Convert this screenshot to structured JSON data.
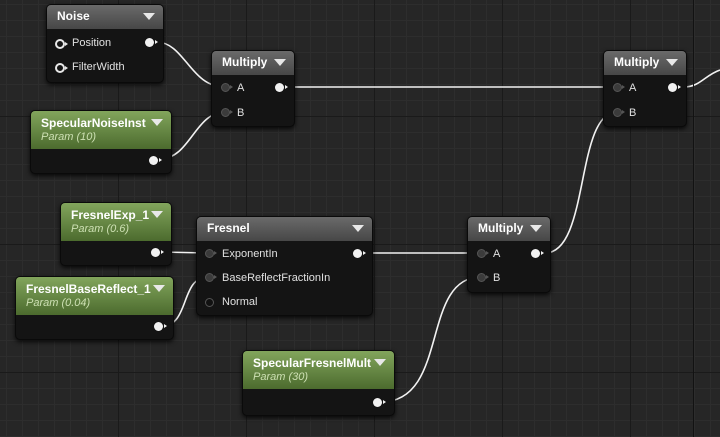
{
  "nodes": {
    "noise": {
      "title": "Noise",
      "inputs": [
        "Position",
        "FilterWidth"
      ]
    },
    "multiply1": {
      "title": "Multiply",
      "inputs": [
        "A",
        "B"
      ]
    },
    "multiply2": {
      "title": "Multiply",
      "inputs": [
        "A",
        "B"
      ]
    },
    "multiply3": {
      "title": "Multiply",
      "inputs": [
        "A",
        "B"
      ]
    },
    "specular_noise_inst": {
      "title": "SpecularNoiseInst",
      "subtitle": "Param (10)"
    },
    "fresnel_exp": {
      "title": "FresnelExp_1",
      "subtitle": "Param (0.6)"
    },
    "fresnel_base_reflect": {
      "title": "FresnelBaseReflect_1",
      "subtitle": "Param (0.04)"
    },
    "specular_fresnel_mult": {
      "title": "SpecularFresnelMult",
      "subtitle": "Param (30)"
    },
    "fresnel": {
      "title": "Fresnel",
      "inputs": [
        "ExponentIn",
        "BaseReflectFractionIn",
        "Normal"
      ]
    }
  },
  "colors": {
    "param_header": "#6f9448",
    "node_header": "#5a5a5a",
    "wire": "#f0f0f0",
    "canvas": "#262626"
  }
}
